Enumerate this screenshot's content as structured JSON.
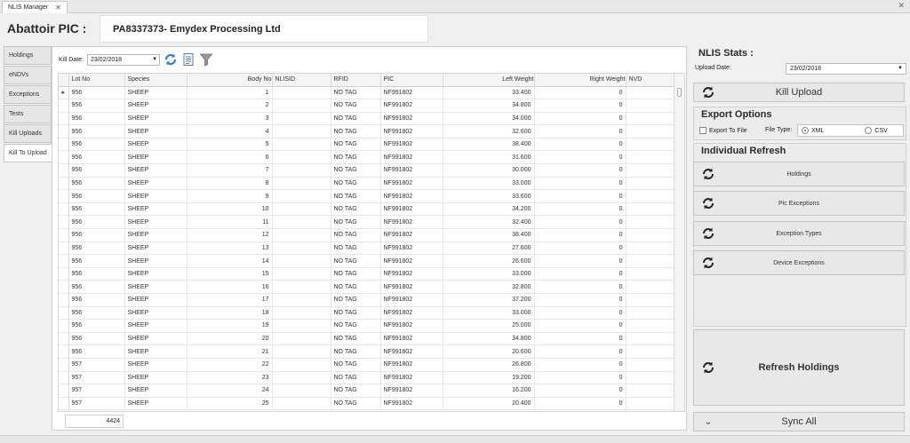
{
  "window": {
    "tab_title": "NLIS Manager",
    "tab_close": "✕",
    "close": "✕"
  },
  "header": {
    "label": "Abattoir PIC  :",
    "value": "PA8337373- Emydex Processing Ltd"
  },
  "nav": {
    "items": [
      "Holdings",
      "eNDVs",
      "Exceptions",
      "Tests",
      "Kill Uploads",
      "Kill To Upload"
    ],
    "active_index": 5
  },
  "toolbar": {
    "kill_date_label": "Kill Date:",
    "kill_date_value": "23/02/2018",
    "icons": [
      "refresh-icon",
      "report-icon",
      "filter-icon"
    ]
  },
  "grid": {
    "columns": [
      "Lot No",
      "Species",
      "Body No",
      "NLISID",
      "RFID",
      "PIC",
      "Left Weight",
      "Right Weight",
      "NVD"
    ],
    "rows": [
      [
        "956",
        "SHEEP",
        "1",
        "",
        "NO TAG",
        "NF991802",
        "33.400",
        "0",
        ""
      ],
      [
        "956",
        "SHEEP",
        "2",
        "",
        "NO TAG",
        "NF991802",
        "34.800",
        "0",
        ""
      ],
      [
        "956",
        "SHEEP",
        "3",
        "",
        "NO TAG",
        "NF991802",
        "34.000",
        "0",
        ""
      ],
      [
        "956",
        "SHEEP",
        "4",
        "",
        "NO TAG",
        "NF991802",
        "32.600",
        "0",
        ""
      ],
      [
        "956",
        "SHEEP",
        "5",
        "",
        "NO TAG",
        "NF991802",
        "38.400",
        "0",
        ""
      ],
      [
        "956",
        "SHEEP",
        "6",
        "",
        "NO TAG",
        "NF991802",
        "31.600",
        "0",
        ""
      ],
      [
        "956",
        "SHEEP",
        "7",
        "",
        "NO TAG",
        "NF991802",
        "30.000",
        "0",
        ""
      ],
      [
        "956",
        "SHEEP",
        "8",
        "",
        "NO TAG",
        "NF991802",
        "33.000",
        "0",
        ""
      ],
      [
        "956",
        "SHEEP",
        "9",
        "",
        "NO TAG",
        "NF991802",
        "33.600",
        "0",
        ""
      ],
      [
        "956",
        "SHEEP",
        "10",
        "",
        "NO TAG",
        "NF991802",
        "34.200",
        "0",
        ""
      ],
      [
        "956",
        "SHEEP",
        "11",
        "",
        "NO TAG",
        "NF991802",
        "32.400",
        "0",
        ""
      ],
      [
        "956",
        "SHEEP",
        "12",
        "",
        "NO TAG",
        "NF991802",
        "38.400",
        "0",
        ""
      ],
      [
        "956",
        "SHEEP",
        "13",
        "",
        "NO TAG",
        "NF991802",
        "27.600",
        "0",
        ""
      ],
      [
        "956",
        "SHEEP",
        "14",
        "",
        "NO TAG",
        "NF991802",
        "26.600",
        "0",
        ""
      ],
      [
        "956",
        "SHEEP",
        "15",
        "",
        "NO TAG",
        "NF991802",
        "33.000",
        "0",
        ""
      ],
      [
        "956",
        "SHEEP",
        "16",
        "",
        "NO TAG",
        "NF991802",
        "32.800",
        "0",
        ""
      ],
      [
        "956",
        "SHEEP",
        "17",
        "",
        "NO TAG",
        "NF991802",
        "37.200",
        "0",
        ""
      ],
      [
        "956",
        "SHEEP",
        "18",
        "",
        "NO TAG",
        "NF991802",
        "33.000",
        "0",
        ""
      ],
      [
        "956",
        "SHEEP",
        "19",
        "",
        "NO TAG",
        "NF991802",
        "25.000",
        "0",
        ""
      ],
      [
        "956",
        "SHEEP",
        "20",
        "",
        "NO TAG",
        "NF991802",
        "34.800",
        "0",
        ""
      ],
      [
        "956",
        "SHEEP",
        "21",
        "",
        "NO TAG",
        "NF991802",
        "20.600",
        "0",
        ""
      ],
      [
        "957",
        "SHEEP",
        "22",
        "",
        "NO TAG",
        "NF991802",
        "26.800",
        "0",
        ""
      ],
      [
        "957",
        "SHEEP",
        "23",
        "",
        "NO TAG",
        "NF991802",
        "19.200",
        "0",
        ""
      ],
      [
        "957",
        "SHEEP",
        "24",
        "",
        "NO TAG",
        "NF991802",
        "16.200",
        "0",
        ""
      ],
      [
        "957",
        "SHEEP",
        "25",
        "",
        "NO TAG",
        "NF991802",
        "20.400",
        "0",
        ""
      ]
    ],
    "current_row_indicator": "▸",
    "total": "4424"
  },
  "right": {
    "stats_title": "NLIS Stats :",
    "upload_date_label": "Upload Date:",
    "upload_date_value": "23/02/2018",
    "kill_upload_label": "Kill Upload",
    "export_title": "Export Options",
    "export_to_file_label": "Export To File",
    "file_type_label": "File Type:",
    "xml_label": "XML",
    "csv_label": "CSV",
    "refresh_title": "Individual Refresh",
    "refresh_buttons": [
      "Holdings",
      "Pic Exceptions",
      "Exception Types",
      "Device Exceptions"
    ],
    "refresh_holdings_label": "Refresh Holdings",
    "sync_all_label": "Sync All",
    "sync_icon": "chevron-down-icon"
  },
  "colors": {
    "icon_blue": "#2f7fd0",
    "refresh_icon": "#222222"
  }
}
